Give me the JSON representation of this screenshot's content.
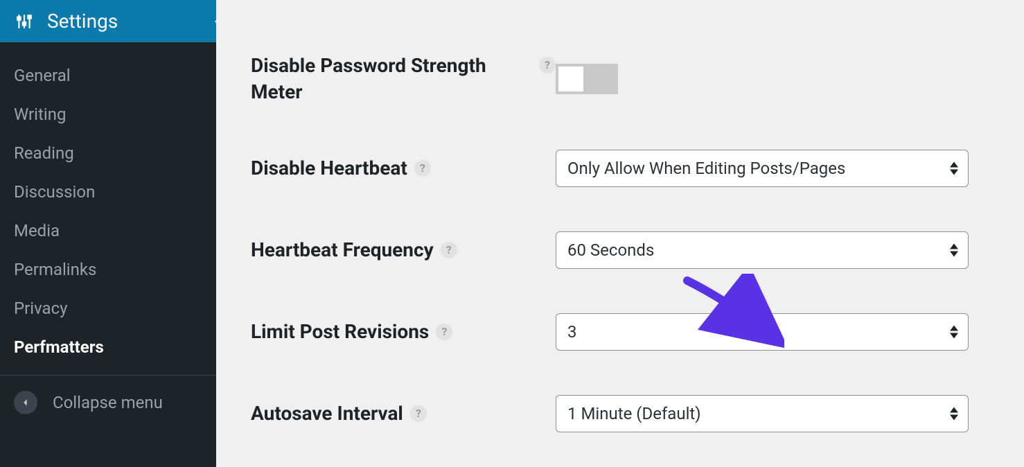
{
  "sidebar": {
    "header": {
      "label": "Settings"
    },
    "items": [
      {
        "label": "General"
      },
      {
        "label": "Writing"
      },
      {
        "label": "Reading"
      },
      {
        "label": "Discussion"
      },
      {
        "label": "Media"
      },
      {
        "label": "Permalinks"
      },
      {
        "label": "Privacy"
      },
      {
        "label": "Perfmatters",
        "active": true
      }
    ],
    "collapse_label": "Collapse menu"
  },
  "settings": {
    "password_meter": {
      "label": "Disable Password Strength Meter",
      "value": false
    },
    "disable_heartbeat": {
      "label": "Disable Heartbeat",
      "value": "Only Allow When Editing Posts/Pages"
    },
    "heartbeat_frequency": {
      "label": "Heartbeat Frequency",
      "value": "60 Seconds"
    },
    "limit_post_revisions": {
      "label": "Limit Post Revisions",
      "value": "3"
    },
    "autosave_interval": {
      "label": "Autosave Interval",
      "value": "1 Minute (Default)"
    }
  },
  "help_glyph": "?"
}
